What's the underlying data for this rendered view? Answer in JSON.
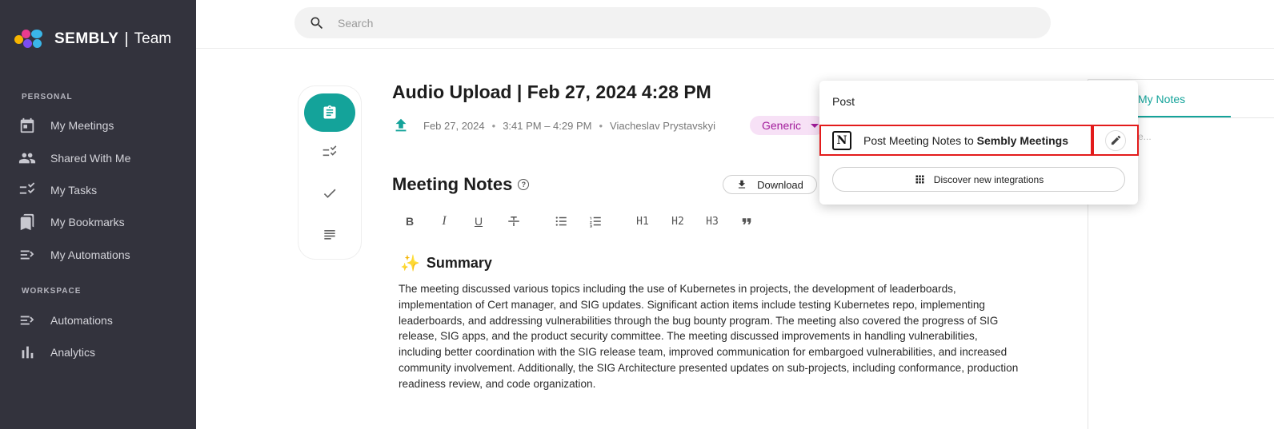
{
  "brand": {
    "name": "SEMBLY",
    "product": "Team",
    "dot_colors": [
      "#f7b500",
      "#e93c8f",
      "#3ab6e8",
      "#7b4df0"
    ]
  },
  "search": {
    "placeholder": "Search"
  },
  "sidebar": {
    "personal_label": "PERSONAL",
    "workspace_label": "WORKSPACE",
    "personal_items": [
      {
        "label": "My Meetings",
        "icon": "calendar-icon"
      },
      {
        "label": "Shared With Me",
        "icon": "people-icon"
      },
      {
        "label": "My Tasks",
        "icon": "checklist-icon"
      },
      {
        "label": "My Bookmarks",
        "icon": "bookmarks-icon"
      },
      {
        "label": "My Automations",
        "icon": "automation-icon"
      }
    ],
    "workspace_items": [
      {
        "label": "Automations",
        "icon": "automation-icon"
      },
      {
        "label": "Analytics",
        "icon": "bar-chart-icon"
      }
    ]
  },
  "meeting": {
    "title": "Audio Upload | Feb 27, 2024 4:28 PM",
    "date": "Feb 27, 2024",
    "time": "3:41 PM – 4:29 PM",
    "owner": "Viacheslav Prystavskyi",
    "tag": "Generic"
  },
  "notes": {
    "heading": "Meeting Notes",
    "download_label": "Download",
    "toolbar": {
      "bold": "B",
      "italic": "I",
      "underline": "U",
      "h1": "H1",
      "h2": "H2",
      "h3": "H3"
    },
    "summary_title": "Summary",
    "summary_text": "The meeting discussed various topics including the use of Kubernetes in projects, the development of leaderboards, implementation of Cert manager, and SIG updates. Significant action items include testing Kubernetes repo, implementing leaderboards, and addressing vulnerabilities through the bug bounty program. The meeting also covered the progress of SIG release, SIG apps, and the product security committee. The meeting discussed improvements in handling vulnerabilities, including better coordination with the SIG release team, improved communication for embargoed vulnerabilities, and increased community involvement. Additionally, the SIG Architecture presented updates on sub-projects, including conformance, production readiness review, and code organization."
  },
  "right_panel": {
    "tab": "My Notes",
    "placeholder": "e..."
  },
  "popover": {
    "title": "Post",
    "integration_prefix": "Post Meeting Notes to ",
    "integration_target": "Sembly Meetings",
    "discover_label": "Discover new integrations"
  },
  "colors": {
    "accent": "#14a39a",
    "sidebar_bg": "#33333d",
    "tag_bg": "#f7e1f6",
    "tag_text": "#a21c9b",
    "highlight": "#e31b1b"
  }
}
